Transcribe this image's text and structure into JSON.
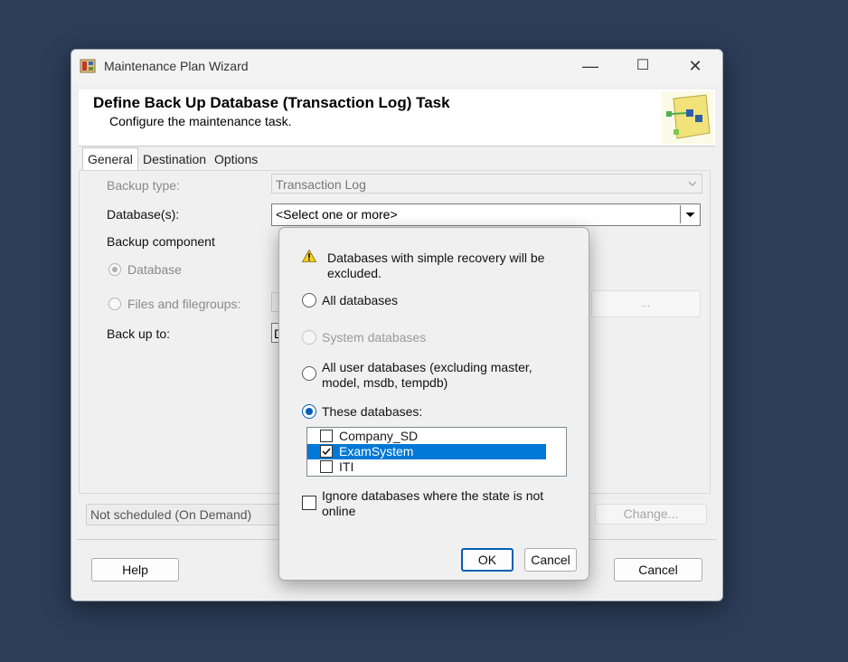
{
  "window": {
    "title": "Maintenance Plan Wizard",
    "controls": {
      "minimize": "—",
      "maximize": "☐",
      "close": "✕"
    }
  },
  "header": {
    "title": "Define Back Up Database (Transaction Log) Task",
    "subtitle": "Configure the maintenance task."
  },
  "tabs": [
    "General",
    "Destination",
    "Options"
  ],
  "general": {
    "backup_type_label": "Backup type:",
    "backup_type_value": "Transaction Log",
    "databases_label": "Database(s):",
    "databases_value": "<Select one or more>",
    "backup_component_label": "Backup component",
    "radio_database": "Database",
    "radio_files": "Files and filegroups:",
    "files_browse": "...",
    "back_up_to_label": "Back up to:",
    "back_up_to_value": "D"
  },
  "schedule": {
    "text": "Not scheduled (On Demand)",
    "change_button": "Change..."
  },
  "footer": {
    "help": "Help",
    "cancel": "Cancel"
  },
  "popup": {
    "warning": "Databases with simple recovery will be excluded.",
    "all_databases": "All databases",
    "system_databases": "System databases",
    "all_user_databases": "All user databases  (excluding master, model, msdb, tempdb)",
    "these_databases": "These databases:",
    "db_list": [
      {
        "name": "Company_SD",
        "checked": false
      },
      {
        "name": "ExamSystem",
        "checked": true
      },
      {
        "name": "ITI",
        "checked": false
      }
    ],
    "ignore_offline": "Ignore databases where the state is not online",
    "ok": "OK",
    "cancel": "Cancel"
  },
  "colors": {
    "desktop": "#2c3d58",
    "selection": "#0078d7",
    "accent": "#005fb8"
  }
}
